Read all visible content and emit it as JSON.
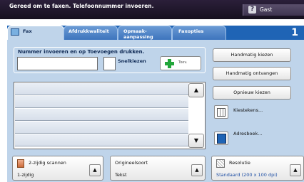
{
  "status_bar": {
    "message": "Gereed om te faxen. Telefoonnummer invoeren.",
    "user": "Gast",
    "user_icon": "?"
  },
  "tabs": [
    {
      "label": "Fax",
      "active": true
    },
    {
      "label": "Afdrukkwaliteit",
      "active": false
    },
    {
      "label": "Opmaak-\naanpassing",
      "active": false
    },
    {
      "label": "Faxopties",
      "active": false
    }
  ],
  "page_number": "1",
  "entry": {
    "title": "Nummer invoeren en op Toevoegen drukken.",
    "number_value": "",
    "speed_dial_label": "Snelkiezen",
    "add_label": "Toev."
  },
  "recipient_list": {
    "rows": [
      "",
      "",
      "",
      "",
      ""
    ]
  },
  "side_buttons": {
    "manual_dial": "Handmatig kiezen",
    "manual_receive": "Handmatig ontvangen",
    "redial": "Opnieuw kiezen",
    "dial_chars": "Kiestekens...",
    "address_book": "Adresboek..."
  },
  "bottom_cards": [
    {
      "title": "2-zijdig scannen",
      "value": "1-zijdig"
    },
    {
      "title": "Origineelsoort",
      "value": "Tekst"
    },
    {
      "title": "Resolutie",
      "value": "Standaard (200 x 100 dpi)"
    }
  ],
  "icons": {
    "user": "help-icon",
    "fax": "fax-icon",
    "add": "plus-icon",
    "dial_chars": "keypad-icon",
    "address_book": "address-book-icon",
    "scan": "duplex-scan-icon",
    "resolution": "resolution-icon"
  },
  "colors": {
    "top_bar": "#1b1428",
    "tab_bar": "#1f64b5",
    "panel": "#bfd4ea",
    "add_icon": "#22a63a",
    "resolution_value": "#1f4fa5"
  }
}
